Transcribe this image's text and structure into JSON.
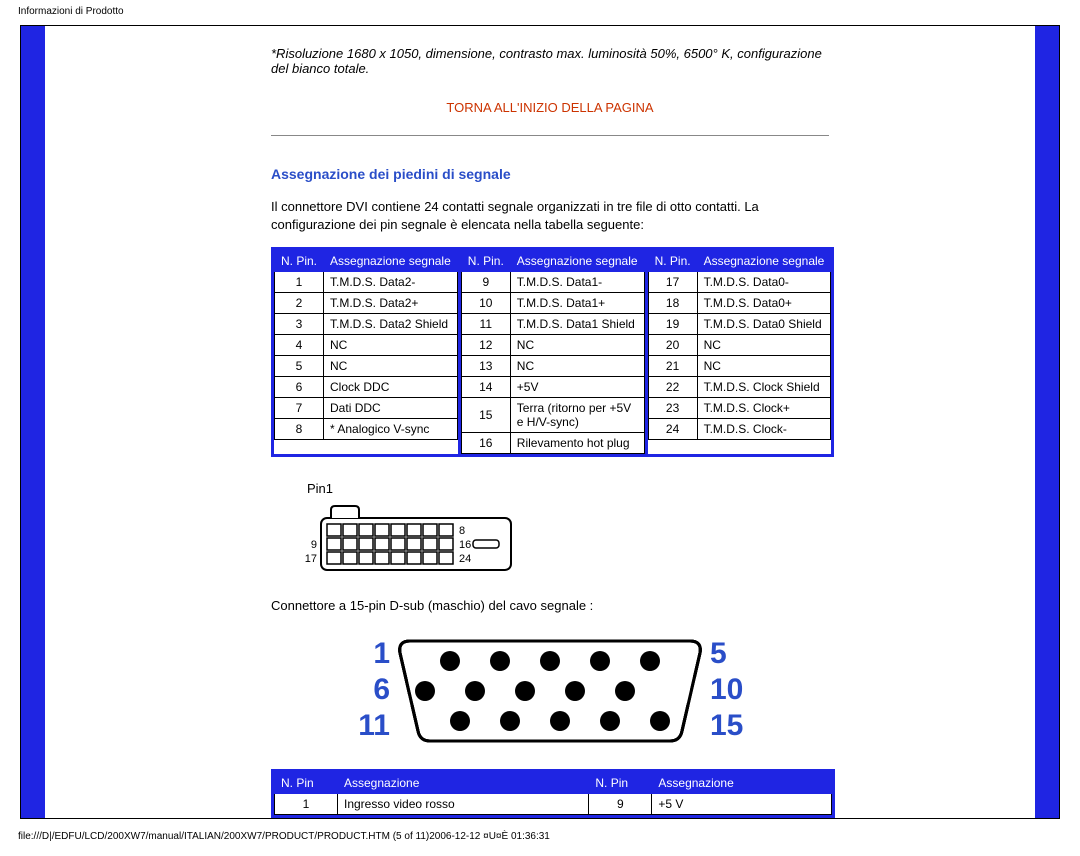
{
  "header_text": "Informazioni di Prodotto",
  "footer_text": "file:///D|/EDFU/LCD/200XW7/manual/ITALIAN/200XW7/PRODUCT/PRODUCT.HTM (5 of 11)2006-12-12 ¤U¤È 01:36:31",
  "note": "*Risoluzione 1680 x 1050, dimensione, contrasto max. luminosità 50%, 6500° K, configurazione del bianco totale.",
  "top_link": "TORNA ALL'INIZIO DELLA PAGINA",
  "section_title": "Assegnazione dei piedini di segnale",
  "intro_para": "Il connettore DVI contiene 24 contatti segnale organizzati in tre file di otto contatti. La configurazione dei pin segnale è elencata nella tabella seguente:",
  "col_pin": "N. Pin.",
  "col_pin2": "N. Pin",
  "col_sig": "Assegnazione segnale",
  "col_asg": "Assegnazione",
  "dvi_col1": [
    {
      "n": "1",
      "s": "T.M.D.S. Data2-"
    },
    {
      "n": "2",
      "s": "T.M.D.S. Data2+"
    },
    {
      "n": "3",
      "s": "T.M.D.S. Data2 Shield"
    },
    {
      "n": "4",
      "s": "NC"
    },
    {
      "n": "5",
      "s": "NC"
    },
    {
      "n": "6",
      "s": "Clock DDC"
    },
    {
      "n": "7",
      "s": "Dati DDC"
    },
    {
      "n": "8",
      "s": "* Analogico V-sync"
    }
  ],
  "dvi_col2": [
    {
      "n": "9",
      "s": "T.M.D.S. Data1-"
    },
    {
      "n": "10",
      "s": "T.M.D.S. Data1+"
    },
    {
      "n": "11",
      "s": "T.M.D.S. Data1 Shield"
    },
    {
      "n": "12",
      "s": "NC"
    },
    {
      "n": "13",
      "s": "NC"
    },
    {
      "n": "14",
      "s": "+5V"
    },
    {
      "n": "15",
      "s": "Terra (ritorno per +5V e H/V-sync)"
    },
    {
      "n": "16",
      "s": "Rilevamento hot plug"
    }
  ],
  "dvi_col3": [
    {
      "n": "17",
      "s": "T.M.D.S. Data0-"
    },
    {
      "n": "18",
      "s": "T.M.D.S. Data0+"
    },
    {
      "n": "19",
      "s": "T.M.D.S. Data0 Shield"
    },
    {
      "n": "20",
      "s": "NC"
    },
    {
      "n": "21",
      "s": "NC"
    },
    {
      "n": "22",
      "s": "T.M.D.S. Clock Shield"
    },
    {
      "n": "23",
      "s": "T.M.D.S. Clock+"
    },
    {
      "n": "24",
      "s": "T.M.D.S. Clock-"
    }
  ],
  "pin1_label": "Pin1",
  "dvi_svg_labels": {
    "l8": "8",
    "l9": "9",
    "l16": "16",
    "l17": "17",
    "l24": "24"
  },
  "conn_text": "Connettore a 15-pin D-sub (maschio) del cavo segnale :",
  "vga_nums": {
    "n1": "1",
    "n5": "5",
    "n6": "6",
    "n10": "10",
    "n11": "11",
    "n15": "15"
  },
  "vga_row": {
    "p1": "1",
    "a1": "Ingresso video rosso",
    "p2": "9",
    "a2": "+5 V"
  }
}
